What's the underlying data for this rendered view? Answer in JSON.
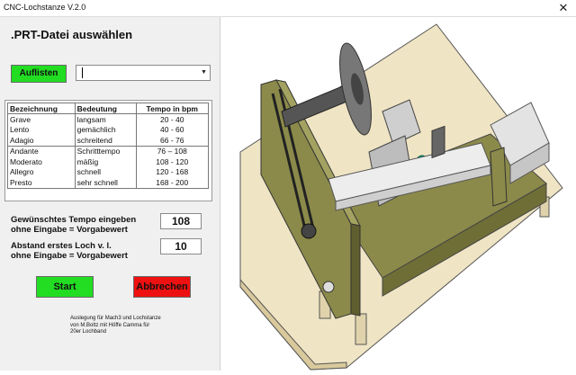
{
  "window": {
    "title": "CNC-Lochstanze V.2.0",
    "close_label": "✕"
  },
  "heading": ".PRT-Datei  auswählen",
  "list_button": "Auflisten",
  "file_combo": {
    "value": "",
    "arrow": "▼"
  },
  "tempo_table": {
    "headers": [
      "Bezeichnung",
      "Bedeutung",
      "Tempo in bpm"
    ],
    "rows": [
      [
        "Grave",
        "langsam",
        "20 - 40"
      ],
      [
        "Lento",
        "gemächlich",
        "40 - 60"
      ],
      [
        "Adagio",
        "schreitend",
        "66 - 76"
      ],
      [
        "Andante",
        "Schritttempo",
        "76 – 108"
      ],
      [
        "Moderato",
        "mäßig",
        "108 - 120"
      ],
      [
        "Allegro",
        "schnell",
        "120 - 168"
      ],
      [
        "Presto",
        "sehr schnell",
        "168 - 200"
      ]
    ]
  },
  "tempo_input": {
    "label_line1": "Gewünschtes Tempo eingeben",
    "label_line2": "ohne Eingabe = Vorgabewert",
    "value": "108"
  },
  "distance_input": {
    "label_line1": "Abstand erstes Loch v. l.",
    "label_line2": "ohne Eingabe = Vorgabewert",
    "value": "10"
  },
  "start_button": "Start",
  "cancel_button": "Abbrechen",
  "note": {
    "line1": "Auslegung für Mach3 und Lochstanze",
    "line2": "von M.Boltz mit Höffe Camma für",
    "line3": "20er Lochband"
  },
  "colors": {
    "go": "#22dd22",
    "abort": "#ee1111",
    "olive": "#8b8a4a",
    "wood": "#e9dcb8"
  }
}
